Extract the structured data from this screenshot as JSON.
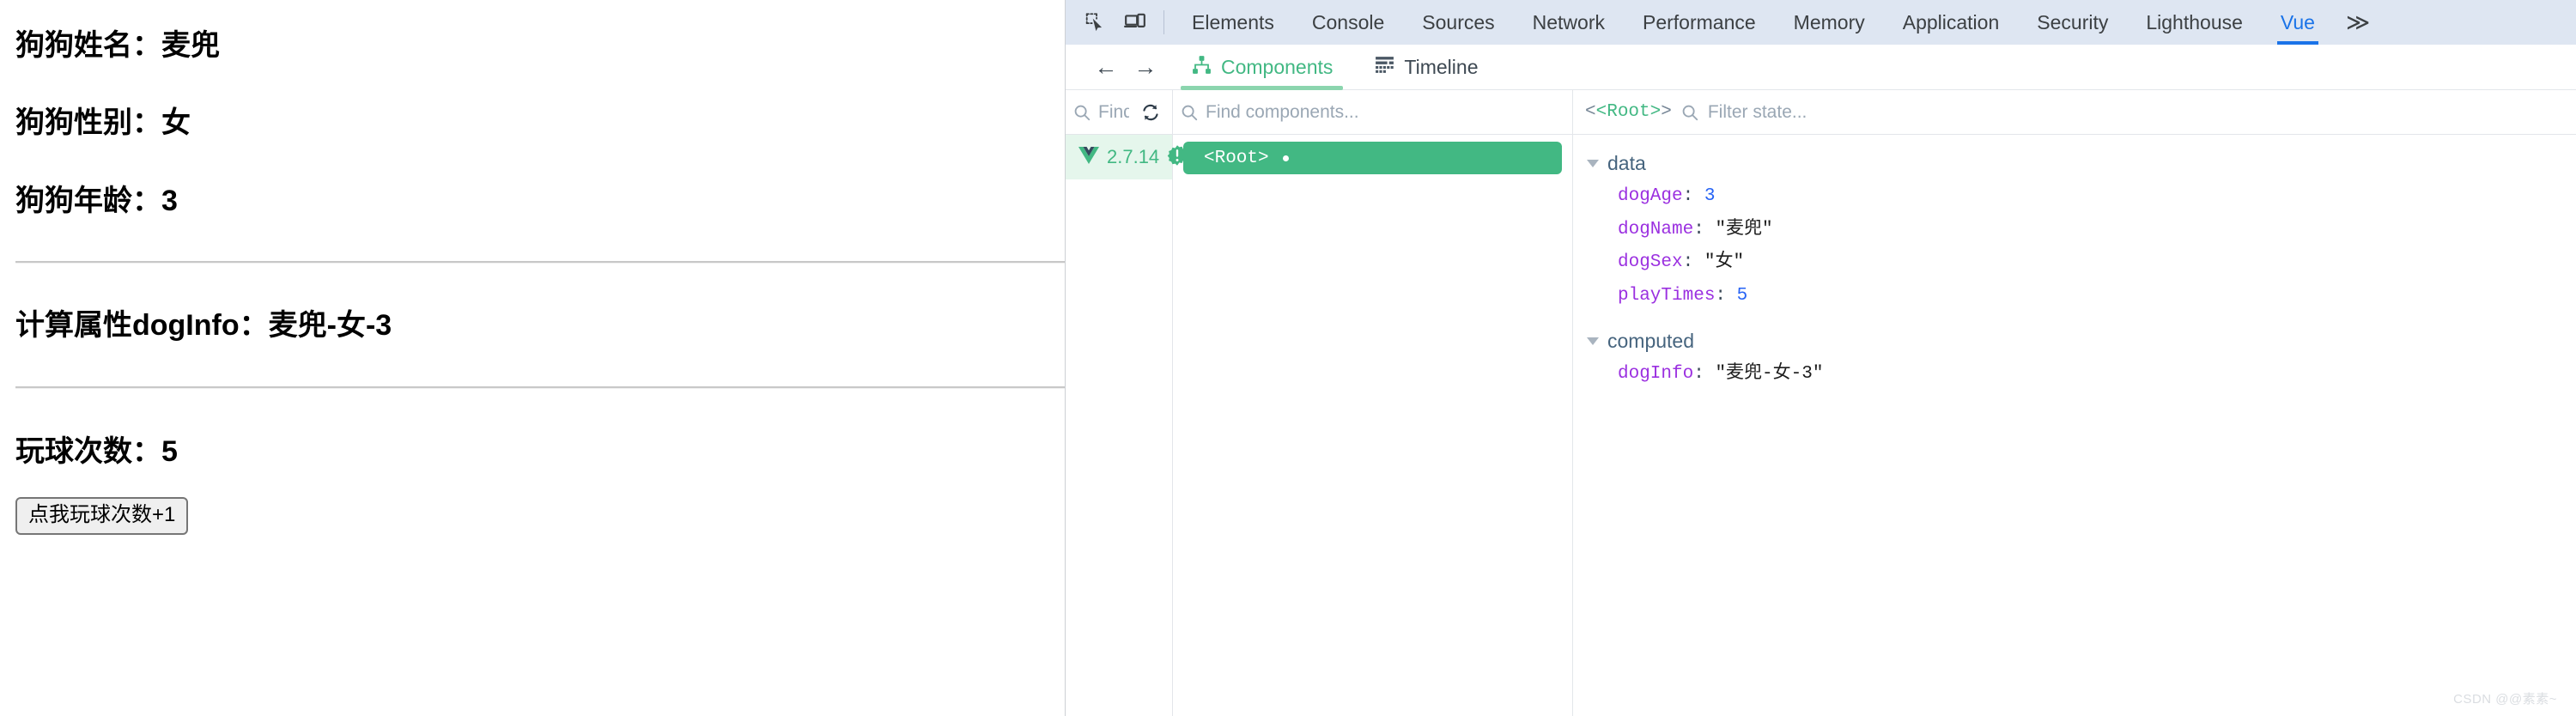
{
  "webpage": {
    "lines": [
      {
        "label": "狗狗姓名：",
        "value": "麦兜"
      },
      {
        "label": "狗狗性别：",
        "value": "女"
      },
      {
        "label": "狗狗年龄：",
        "value": "3"
      }
    ],
    "computed_line": {
      "label": "计算属性dogInfo：",
      "value": "麦兜-女-3"
    },
    "play_line": {
      "label": "玩球次数：",
      "value": "5"
    },
    "button_label": "点我玩球次数+1"
  },
  "devtools": {
    "icons": {
      "inspect": "inspect-element-icon",
      "device": "device-toolbar-icon"
    },
    "tabs": [
      {
        "label": "Elements",
        "active": false
      },
      {
        "label": "Console",
        "active": false
      },
      {
        "label": "Sources",
        "active": false
      },
      {
        "label": "Network",
        "active": false
      },
      {
        "label": "Performance",
        "active": false
      },
      {
        "label": "Memory",
        "active": false
      },
      {
        "label": "Application",
        "active": false
      },
      {
        "label": "Security",
        "active": false
      },
      {
        "label": "Lighthouse",
        "active": false
      },
      {
        "label": "Vue",
        "active": true
      }
    ],
    "more_label": "≫",
    "accent_blue": "#1a73e8",
    "tabbar_bg": "#dee6f2"
  },
  "vue_panel": {
    "nav": {
      "back": "←",
      "forward": "→"
    },
    "tabs": [
      {
        "label": "Components",
        "active": true,
        "icon": "component-tree-icon"
      },
      {
        "label": "Timeline",
        "active": false,
        "icon": "timeline-icon"
      }
    ],
    "accent_green": "#42b883",
    "tree_search_placeholder": "Find a",
    "component_search_placeholder": "Find components...",
    "version": "2.7.14",
    "root_node": "<Root>",
    "state_root_label": "<Root>",
    "state_filter_placeholder": "Filter state...",
    "groups": [
      {
        "name": "data",
        "entries": [
          {
            "key": "dogAge",
            "value": "3",
            "type": "number"
          },
          {
            "key": "dogName",
            "value": "\"麦兜\"",
            "type": "string"
          },
          {
            "key": "dogSex",
            "value": "\"女\"",
            "type": "string"
          },
          {
            "key": "playTimes",
            "value": "5",
            "type": "number"
          }
        ]
      },
      {
        "name": "computed",
        "entries": [
          {
            "key": "dogInfo",
            "value": "\"麦兜-女-3\"",
            "type": "string"
          }
        ]
      }
    ]
  },
  "watermark": "CSDN @@素素~"
}
